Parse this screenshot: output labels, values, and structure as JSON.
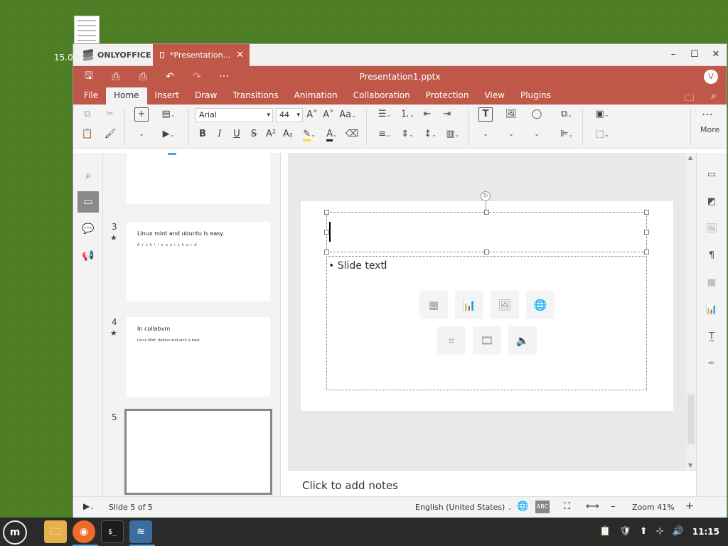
{
  "desktop": {
    "clock_partial": "15.0"
  },
  "window": {
    "brand": "ONLYOFFICE",
    "tab_label": "*Presentation...",
    "tab_close": "✕",
    "controls": {
      "minimize": "–",
      "maximize": "☐",
      "close": "✕"
    }
  },
  "header": {
    "doc_title": "Presentation1.pptx",
    "avatar": "V",
    "quick": {
      "save": "🖫",
      "print": "⎙",
      "quick_print": "⎙",
      "undo": "↶",
      "redo": "↷",
      "more": "···"
    }
  },
  "menubar": {
    "items": [
      "File",
      "Home",
      "Insert",
      "Draw",
      "Transitions",
      "Animation",
      "Collaboration",
      "Protection",
      "View",
      "Plugins"
    ],
    "active": "Home"
  },
  "toolbar": {
    "font_name": "Arial",
    "font_size": "44",
    "case_label": "Aa",
    "grow_font": "A˄",
    "shrink_font": "A˅",
    "bold": "B",
    "italic": "I",
    "underline": "U",
    "strikethrough": "S",
    "superscript": "A²",
    "subscript": "A₂",
    "more_label": "More"
  },
  "slides": [
    {
      "number": "3",
      "title": "Linux mint and ubuntu is easy",
      "subtitle": "A r c h  l i n u x  i s  h a r d",
      "star": "★"
    },
    {
      "number": "4",
      "title": "In collabvm",
      "subtitle": "Linux Mint, debian and arch is best",
      "star": "★"
    },
    {
      "number": "5",
      "title": "",
      "subtitle": "",
      "star": ""
    }
  ],
  "slide": {
    "body_text": "• Slide text",
    "placeholder_icons": [
      "table-icon",
      "chart-icon",
      "image-icon",
      "image-url-icon",
      "smartart-icon",
      "video-icon",
      "audio-icon"
    ]
  },
  "notes": {
    "placeholder": "Click to add notes"
  },
  "status": {
    "slide_counter": "Slide 5 of 5",
    "language": "English (United States)",
    "zoom": "Zoom 41%",
    "zoom_minus": "–",
    "zoom_plus": "+"
  },
  "taskbar": {
    "clock": "11:15"
  },
  "colors": {
    "accent": "#c0584a",
    "toolbar_bg": "#f3f3f3",
    "desktop": "#4e7e25"
  }
}
